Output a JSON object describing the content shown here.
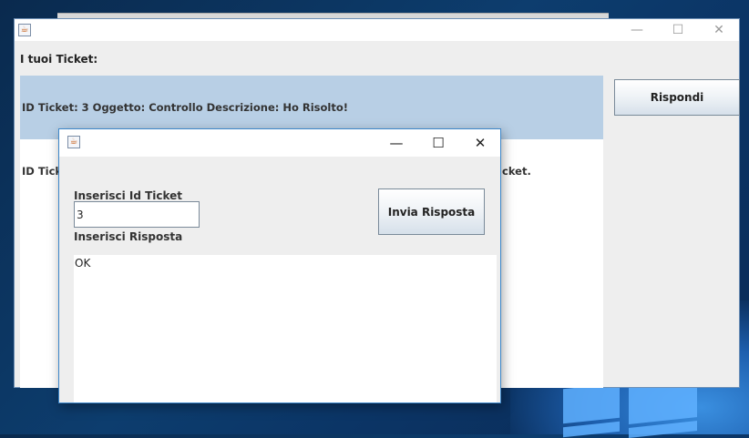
{
  "main_window": {
    "header": "I tuoi Ticket:",
    "controls": {
      "minimize": "—",
      "maximize": "☐",
      "close": "✕"
    },
    "tickets": [
      "ID Ticket: 3  Oggetto:  Controllo  Descrizione:  Ho Risolto!",
      "ID Ticket"
    ],
    "ticket_overflow_text": "cket.",
    "reply_button": "Rispondi"
  },
  "dialog": {
    "controls": {
      "minimize": "—",
      "maximize": "☐",
      "close": "✕"
    },
    "id_label": "Inserisci Id Ticket",
    "id_value": "3",
    "reply_label": "Inserisci Risposta",
    "reply_value": "OK",
    "send_button": "Invia Risposta"
  },
  "colors": {
    "selection": "#b8cfe5",
    "dialog_border": "#3c86c9"
  }
}
